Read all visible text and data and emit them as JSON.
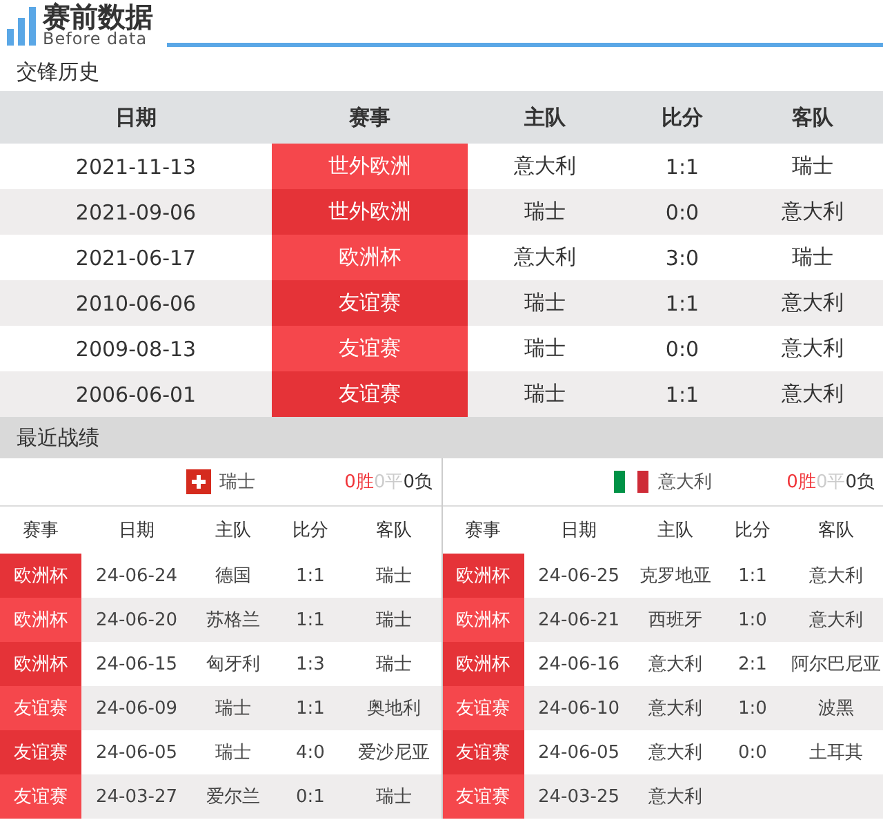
{
  "logo": {
    "title": "赛前数据",
    "subtitle": "Before data"
  },
  "history": {
    "title": "交锋历史",
    "columns": [
      "日期",
      "赛事",
      "主队",
      "比分",
      "客队"
    ],
    "rows": [
      {
        "date": "2021-11-13",
        "event": "世外欧洲",
        "home": "意大利",
        "score": "1:1",
        "away": "瑞士"
      },
      {
        "date": "2021-09-06",
        "event": "世外欧洲",
        "home": "瑞士",
        "score": "0:0",
        "away": "意大利"
      },
      {
        "date": "2021-06-17",
        "event": "欧洲杯",
        "home": "意大利",
        "score": "3:0",
        "away": "瑞士"
      },
      {
        "date": "2010-06-06",
        "event": "友谊赛",
        "home": "瑞士",
        "score": "1:1",
        "away": "意大利"
      },
      {
        "date": "2009-08-13",
        "event": "友谊赛",
        "home": "瑞士",
        "score": "0:0",
        "away": "意大利"
      },
      {
        "date": "2006-06-01",
        "event": "友谊赛",
        "home": "瑞士",
        "score": "1:1",
        "away": "意大利"
      }
    ]
  },
  "recent": {
    "title": "最近战绩",
    "teams": [
      {
        "name": "瑞士",
        "kind": "swiss",
        "wins": "0胜",
        "draws": "0平",
        "losses": "0负",
        "columns": [
          "赛事",
          "日期",
          "主队",
          "比分",
          "客队"
        ],
        "rows": [
          {
            "event": "欧洲杯",
            "date": "24-06-24",
            "home": "德国",
            "score": "1:1",
            "away": "瑞士"
          },
          {
            "event": "欧洲杯",
            "date": "24-06-20",
            "home": "苏格兰",
            "score": "1:1",
            "away": "瑞士"
          },
          {
            "event": "欧洲杯",
            "date": "24-06-15",
            "home": "匈牙利",
            "score": "1:3",
            "away": "瑞士"
          },
          {
            "event": "友谊赛",
            "date": "24-06-09",
            "home": "瑞士",
            "score": "1:1",
            "away": "奥地利"
          },
          {
            "event": "友谊赛",
            "date": "24-06-05",
            "home": "瑞士",
            "score": "4:0",
            "away": "爱沙尼亚"
          },
          {
            "event": "友谊赛",
            "date": "24-03-27",
            "home": "爱尔兰",
            "score": "0:1",
            "away": "瑞士"
          }
        ]
      },
      {
        "name": "意大利",
        "kind": "italy",
        "wins": "0胜",
        "draws": "0平",
        "losses": "0负",
        "columns": [
          "赛事",
          "日期",
          "主队",
          "比分",
          "客队"
        ],
        "rows": [
          {
            "event": "欧洲杯",
            "date": "24-06-25",
            "home": "克罗地亚",
            "score": "1:1",
            "away": "意大利"
          },
          {
            "event": "欧洲杯",
            "date": "24-06-21",
            "home": "西班牙",
            "score": "1:0",
            "away": "意大利"
          },
          {
            "event": "欧洲杯",
            "date": "24-06-16",
            "home": "意大利",
            "score": "2:1",
            "away": "阿尔巴尼亚"
          },
          {
            "event": "友谊赛",
            "date": "24-06-10",
            "home": "意大利",
            "score": "1:0",
            "away": "波黑"
          },
          {
            "event": "友谊赛",
            "date": "24-06-05",
            "home": "意大利",
            "score": "0:0",
            "away": "土耳其"
          },
          {
            "event": "友谊赛",
            "date": "24-03-25",
            "home": "意大利"
          }
        ]
      }
    ]
  }
}
